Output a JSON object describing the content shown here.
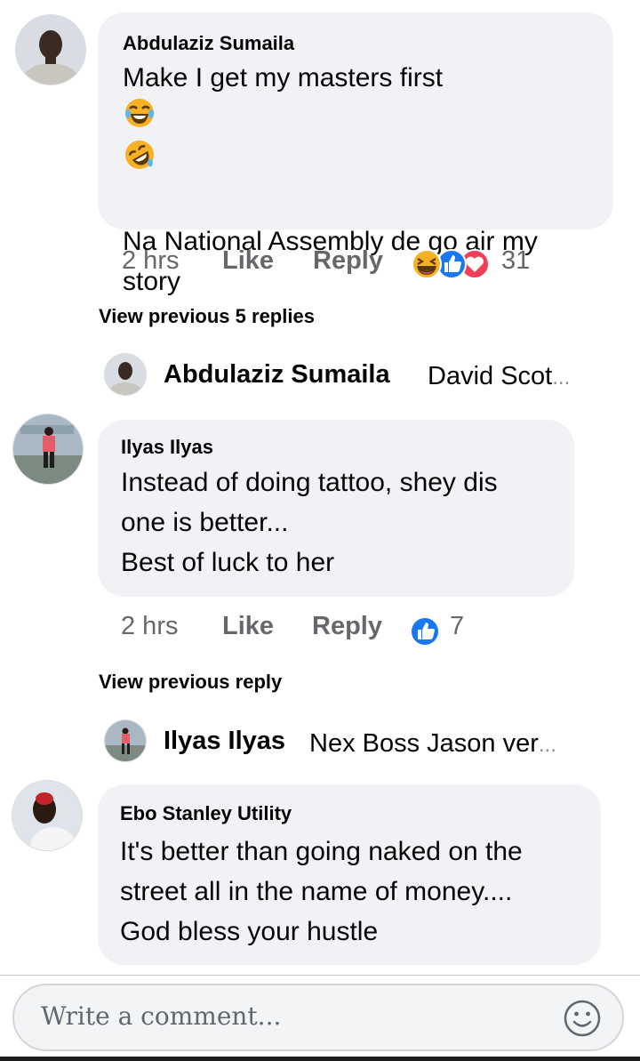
{
  "comments": [
    {
      "author": "Abdulaziz Sumaila",
      "lines": [
        "Make I get my masters first",
        "",
        "Na National Assembly de go air my",
        "story"
      ],
      "time": "2 hrs",
      "like_label": "Like",
      "reply_label": "Reply",
      "reaction_count": "31",
      "reactions": [
        "haha-emoji",
        "like-emoji",
        "love-emoji"
      ]
    },
    {
      "author": "Ilyas Ilyas",
      "lines": [
        "Instead of doing tattoo, shey dis",
        "one is better...",
        "Best of luck to her"
      ],
      "time": "2 hrs",
      "like_label": "Like",
      "reply_label": "Reply",
      "reaction_count": "7",
      "reactions": [
        "like-emoji"
      ]
    },
    {
      "author": "Ebo Stanley Utility",
      "lines": [
        "It's better than going naked on the",
        "street all in the name of money....",
        "God bless your hustle"
      ]
    }
  ],
  "view_previous": [
    "View previous 5 replies",
    "View previous reply"
  ],
  "reply_previews": [
    {
      "name": "Abdulaziz Sumaila",
      "snippet": "David Scot",
      "ellipsis": "..."
    },
    {
      "name": "Ilyas Ilyas",
      "snippet": "Nex Boss Jason ver",
      "ellipsis": "..."
    }
  ],
  "composer": {
    "placeholder": "Write a comment...",
    "icon": "smiley-icon"
  },
  "colors": {
    "bubble": "#f0f2f5",
    "meta": "#65676b",
    "like_blue": "#1877f2",
    "love_red": "#f33e58",
    "haha_yellow": "#f7b125"
  }
}
